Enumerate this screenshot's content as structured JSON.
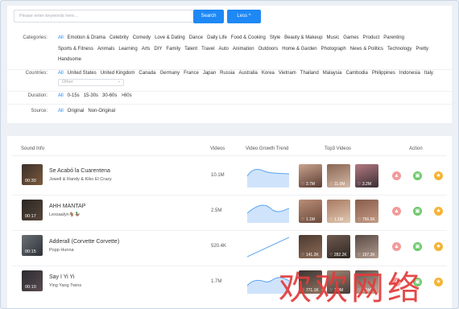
{
  "search": {
    "placeholder": "Please enter keywords here...",
    "search_label": "Search",
    "less_label": "Less ^"
  },
  "filters": {
    "categories": {
      "label": "Categories:",
      "options": [
        "All",
        "Emotion & Drama",
        "Celebrity",
        "Comedy",
        "Love & Dating",
        "Dance",
        "Daily Life",
        "Food & Cooking",
        "Style",
        "Beauty & Makeup",
        "Music",
        "Games",
        "Product",
        "Parenting",
        "Sports & Fitness",
        "Animals",
        "Learning",
        "Arts",
        "DIY",
        "Family",
        "Talent",
        "Travel",
        "Auto",
        "Animation",
        "Outdoors",
        "Home & Garden",
        "Photograph",
        "News & Politics",
        "Technology",
        "Pretty",
        "Handsome"
      ]
    },
    "countries": {
      "label": "Countries:",
      "options": [
        "All",
        "United States",
        "United Kingdom",
        "Canada",
        "Germany",
        "France",
        "Japan",
        "Russia",
        "Australia",
        "Korea",
        "Vietnam",
        "Thailand",
        "Malaysia",
        "Cambodia",
        "Philippines",
        "Indonesia",
        "Italy"
      ],
      "other_placeholder": "Other"
    },
    "duration": {
      "label": "Duration:",
      "options": [
        "All",
        "0-15s",
        "15-30s",
        "30-60s",
        ">60s"
      ]
    },
    "source": {
      "label": "Source:",
      "options": [
        "All",
        "Original",
        "Non-Original"
      ]
    }
  },
  "table": {
    "headers": {
      "sound": "Sound Info",
      "videos": "Videos",
      "trend": "Video Growth Trend",
      "top3": "Top3 Videos",
      "action": "Action"
    },
    "rows": [
      {
        "title": "Se Acabó la Cuarentena",
        "artist": "Jowell & Randy & Kiko El Crazy",
        "duration": "00:30",
        "videos": "10.1M",
        "top": [
          "3.7M",
          "11.0M",
          "3.2M"
        ]
      },
      {
        "title": "AHH MANTAP",
        "artist": "Lexsaalyn🐐🦆",
        "duration": "00:17",
        "videos": "2.5M",
        "top": [
          "1.1M",
          "1.1M",
          "756.5K"
        ]
      },
      {
        "title": "Adderall (Corvette Corvette)",
        "artist": "Popp Hunna",
        "duration": "00:15",
        "videos": "520.4K",
        "top": [
          "141.2K",
          "282.2K",
          "197.3K"
        ]
      },
      {
        "title": "Say I Yi Yi",
        "artist": "Ying Yang Twins",
        "duration": "00:10",
        "videos": "1.7M",
        "top": [
          "771.1K",
          "1.9M",
          "1.5M"
        ]
      }
    ]
  },
  "colors": {
    "accent": "#1e88f5",
    "trend": "#5aa3f0",
    "action_red": "#f29b9b",
    "action_green": "#6cc86a",
    "action_yellow": "#f5b335"
  },
  "watermark": "欢欢网络"
}
